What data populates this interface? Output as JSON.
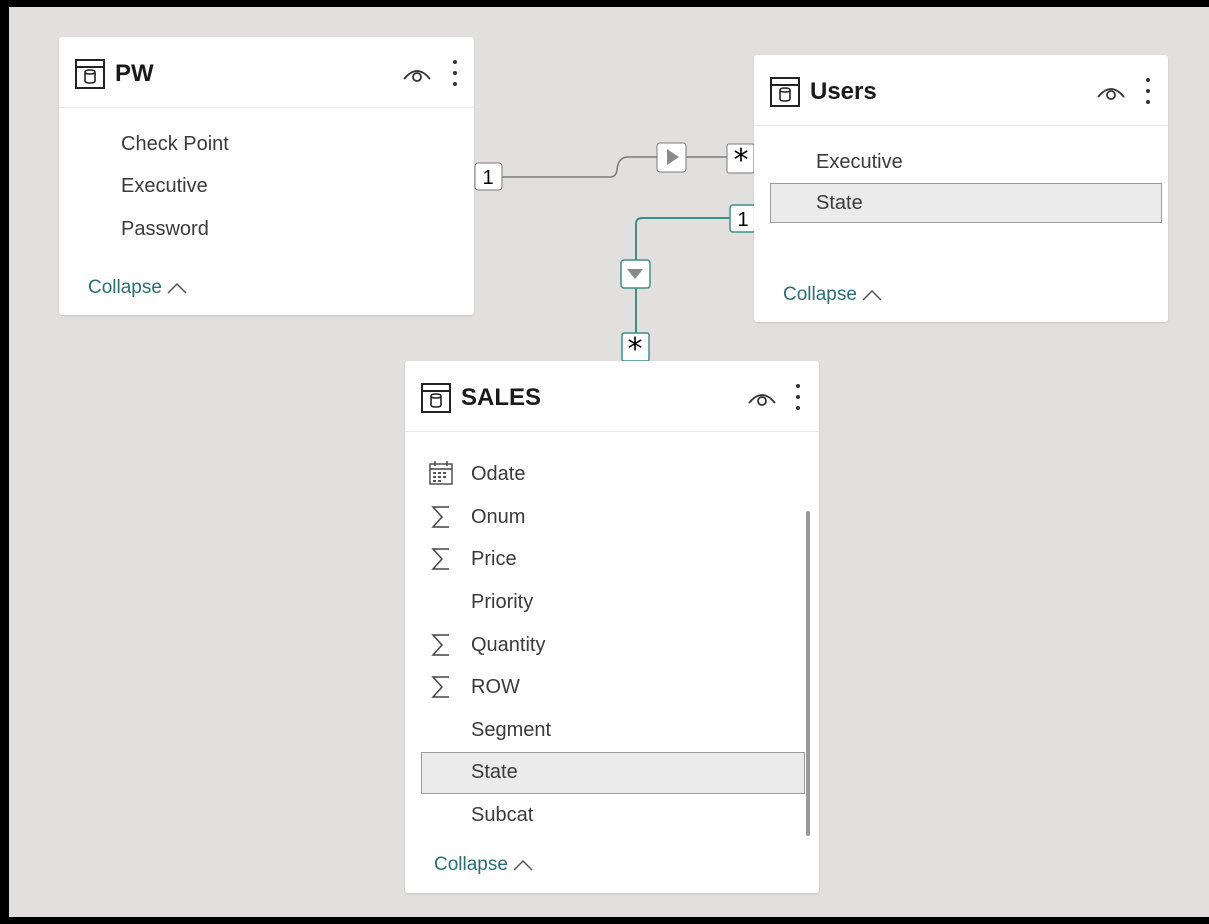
{
  "tables": {
    "pw": {
      "title": "PW",
      "fields": [
        "Check Point",
        "Executive",
        "Password"
      ],
      "collapse_label": "Collapse"
    },
    "users": {
      "title": "Users",
      "fields": [
        "Executive",
        "State"
      ],
      "collapse_label": "Collapse"
    },
    "sales": {
      "title": "SALES",
      "fields": [
        {
          "label": "Odate",
          "icon": "calendar-icon"
        },
        {
          "label": "Onum",
          "icon": "sigma-icon"
        },
        {
          "label": "Price",
          "icon": "sigma-icon"
        },
        {
          "label": "Priority",
          "icon": ""
        },
        {
          "label": "Quantity",
          "icon": "sigma-icon"
        },
        {
          "label": "ROW",
          "icon": "sigma-icon"
        },
        {
          "label": "Segment",
          "icon": ""
        },
        {
          "label": "State",
          "icon": ""
        },
        {
          "label": "Subcat",
          "icon": ""
        }
      ],
      "collapse_label": "Collapse"
    }
  },
  "relationships": {
    "pw_users": {
      "one_label": "1",
      "many_label": "*"
    },
    "users_sales": {
      "one_label": "1",
      "many_label": "*"
    }
  },
  "colors": {
    "canvas": "#e1e0df",
    "accent": "#2b6e73",
    "relationship_teal": "#3f8f88",
    "relationship_gray": "#7a7a7a"
  }
}
